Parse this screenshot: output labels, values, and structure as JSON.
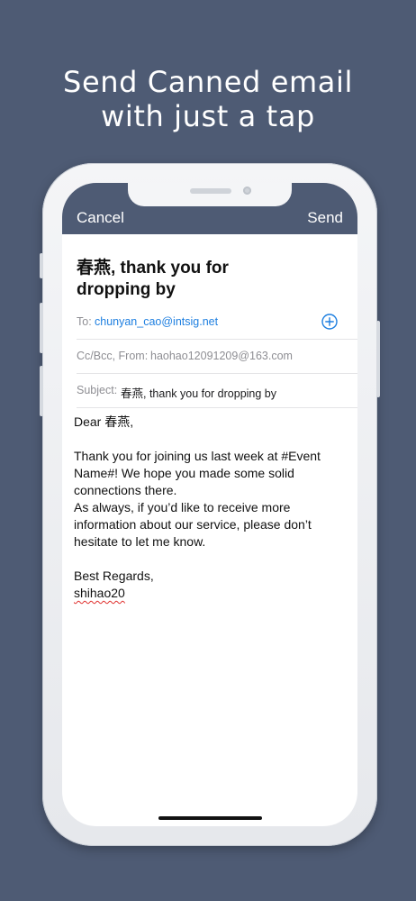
{
  "headline": {
    "line1": "Send Canned email",
    "line2": "with just a tap"
  },
  "navbar": {
    "cancel_label": "Cancel",
    "send_label": "Send"
  },
  "email": {
    "title_line1": "春燕, thank you for",
    "title_line2": "dropping by",
    "to_label": "To:",
    "to_value": "chunyan_cao@intsig.net",
    "cc_label": "Cc/Bcc, From:",
    "cc_value": "haohao12091209@163.com",
    "subject_label": "Subject:",
    "subject_value": "春燕, thank you for dropping by",
    "body": {
      "greeting": "Dear 春燕,",
      "line1": "Thank you for joining us last week at #Event",
      "line2": "Name#! We hope you made some solid",
      "line3": "connections there.",
      "line4": "As always, if you’d like to receive more",
      "line5": "information about our service, please don’t",
      "line6": "hesitate to let me know.",
      "signoff": "Best Regards,",
      "signature": "shihao20"
    }
  },
  "colors": {
    "background": "#4e5b74",
    "navbar": "#4e5b74",
    "link": "#1e7fe0",
    "spellcheck": "#e0302e"
  },
  "icons": {
    "add_recipient": "plus-circle-icon"
  }
}
